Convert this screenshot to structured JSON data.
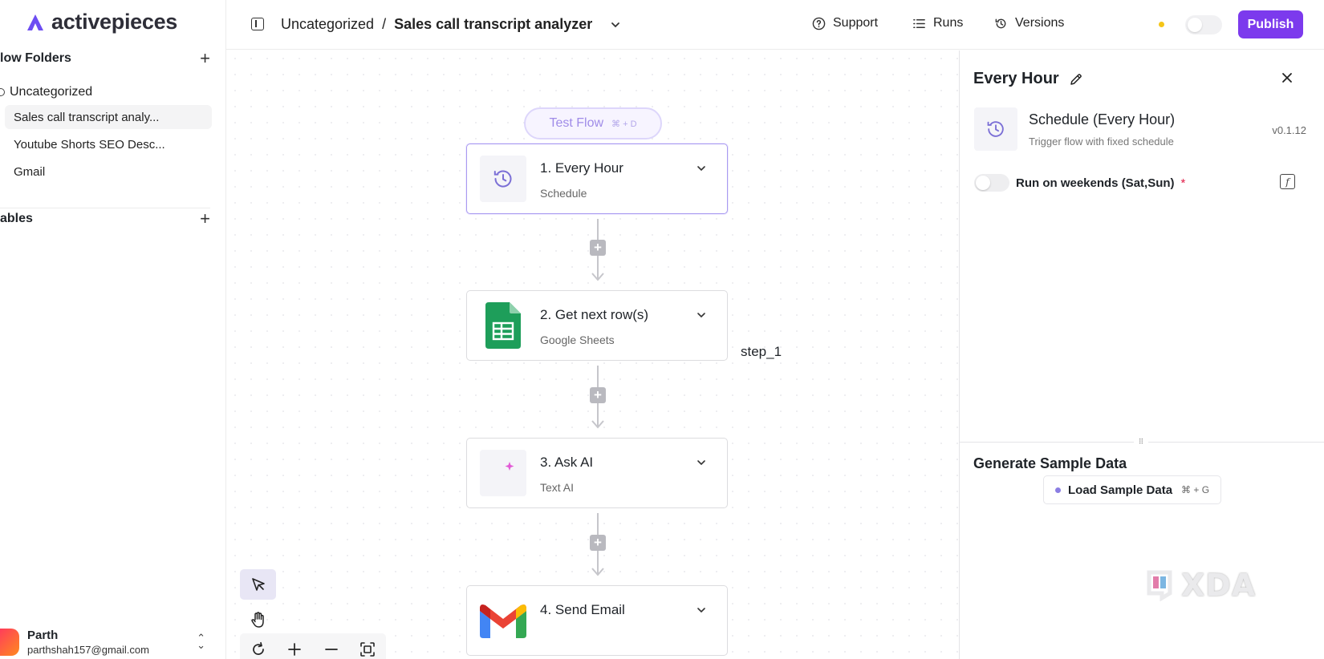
{
  "app": {
    "name": "activepieces"
  },
  "sidebar": {
    "flow_folders_label": "low Folders",
    "folder_name": "Uncategorized",
    "flows": [
      "Sales call transcript analy...",
      "Youtube Shorts SEO Desc...",
      "Gmail"
    ],
    "tables_label": "ables",
    "user": {
      "name": "Parth",
      "email": "parthshah157@gmail.com"
    }
  },
  "header": {
    "breadcrumb_folder": "Uncategorized",
    "separator": "/",
    "flow_title": "Sales call transcript analyzer",
    "support_label": "Support",
    "runs_label": "Runs",
    "versions_label": "Versions",
    "publish_label": "Publish"
  },
  "canvas": {
    "test_flow_label": "Test Flow",
    "test_flow_shortcut": "⌘ + D",
    "step_label": "step_1",
    "nodes": [
      {
        "title": "1. Every Hour",
        "subtitle": "Schedule"
      },
      {
        "title": "2. Get next row(s)",
        "subtitle": "Google Sheets"
      },
      {
        "title": "3. Ask AI",
        "subtitle": "Text AI"
      },
      {
        "title": "4. Send Email",
        "subtitle": ""
      }
    ]
  },
  "panel": {
    "title": "Every Hour",
    "piece_name": "Schedule (Every Hour)",
    "piece_description": "Trigger flow with fixed schedule",
    "version": "v0.1.12",
    "weekend_label": "Run on weekends (Sat,Sun)",
    "required_mark": "*",
    "generate_title": "Generate Sample Data",
    "load_sample_label": "Load Sample Data",
    "load_sample_shortcut": "⌘ + G"
  },
  "watermark": {
    "text": "XDA"
  },
  "colors": {
    "accent": "#7c3aed",
    "schedule_icon": "#7b6fd6",
    "sheets_green": "#1e9e5a",
    "required": "#e11d48"
  },
  "icons": {
    "sidebar_toggle": "sidebar-toggle-icon",
    "support": "help-circle-icon",
    "runs": "list-icon",
    "versions": "history-icon",
    "schedule": "clock-icon",
    "sheets": "google-sheets-icon",
    "ai": "sparkle-lines-icon",
    "gmail": "gmail-icon"
  }
}
